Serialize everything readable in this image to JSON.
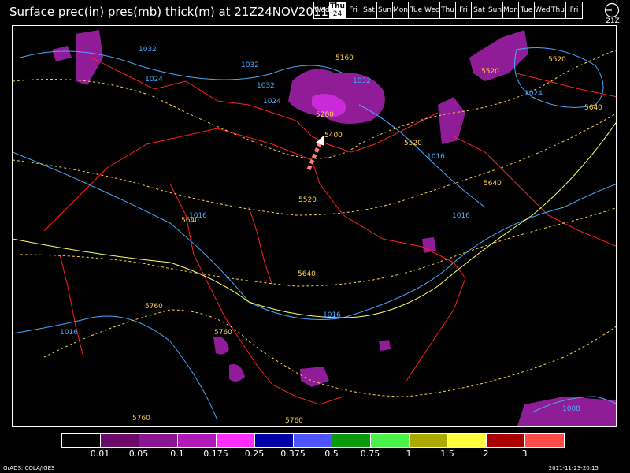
{
  "header": {
    "title": "Surface prec(in) pres(mb) thick(m) at 21Z24NOV2011",
    "days": [
      "Wed",
      "Thu",
      "Fri",
      "Sat",
      "Sun",
      "Mon",
      "Tue",
      "Wed",
      "Thu",
      "Fri",
      "Sat",
      "Sun",
      "Mon",
      "Tue",
      "Wed",
      "Thu",
      "Fri"
    ],
    "active_day_index": 1,
    "active_day_number": "24",
    "hour_label": "21Z"
  },
  "map": {
    "pressure_labels": [
      "1032",
      "1024",
      "1032",
      "1032",
      "1024",
      "1016",
      "1016",
      "1016",
      "1016",
      "1032",
      "1024",
      "1016",
      "1008"
    ],
    "thickness_labels": [
      "5160",
      "5280",
      "5400",
      "5520",
      "5520",
      "5640",
      "5640",
      "5640",
      "5760",
      "5760",
      "5760",
      "5760",
      "5520",
      "5520",
      "5640"
    ],
    "colors": {
      "pressure": "#4aa8ff",
      "thickness_low": "#ffd24a",
      "thickness_high": "#ffff66",
      "borders": "#ff2020"
    }
  },
  "legend": {
    "colors": [
      "#000000",
      "#6a0a6a",
      "#8c1591",
      "#b21ab8",
      "#ff2fff",
      "#0000a8",
      "#4e54ff",
      "#0c9a0c",
      "#4cf24c",
      "#aaaa00",
      "#ffff40",
      "#aa0000",
      "#ff4a4a"
    ],
    "labels": [
      "0.01",
      "0.05",
      "0.1",
      "0.175",
      "0.25",
      "0.375",
      "0.5",
      "0.75",
      "1",
      "1.5",
      "2",
      "3"
    ]
  },
  "footer": {
    "credit": "GrADS: COLA/IGES",
    "timestamp": "2011-11-23-20:15"
  }
}
